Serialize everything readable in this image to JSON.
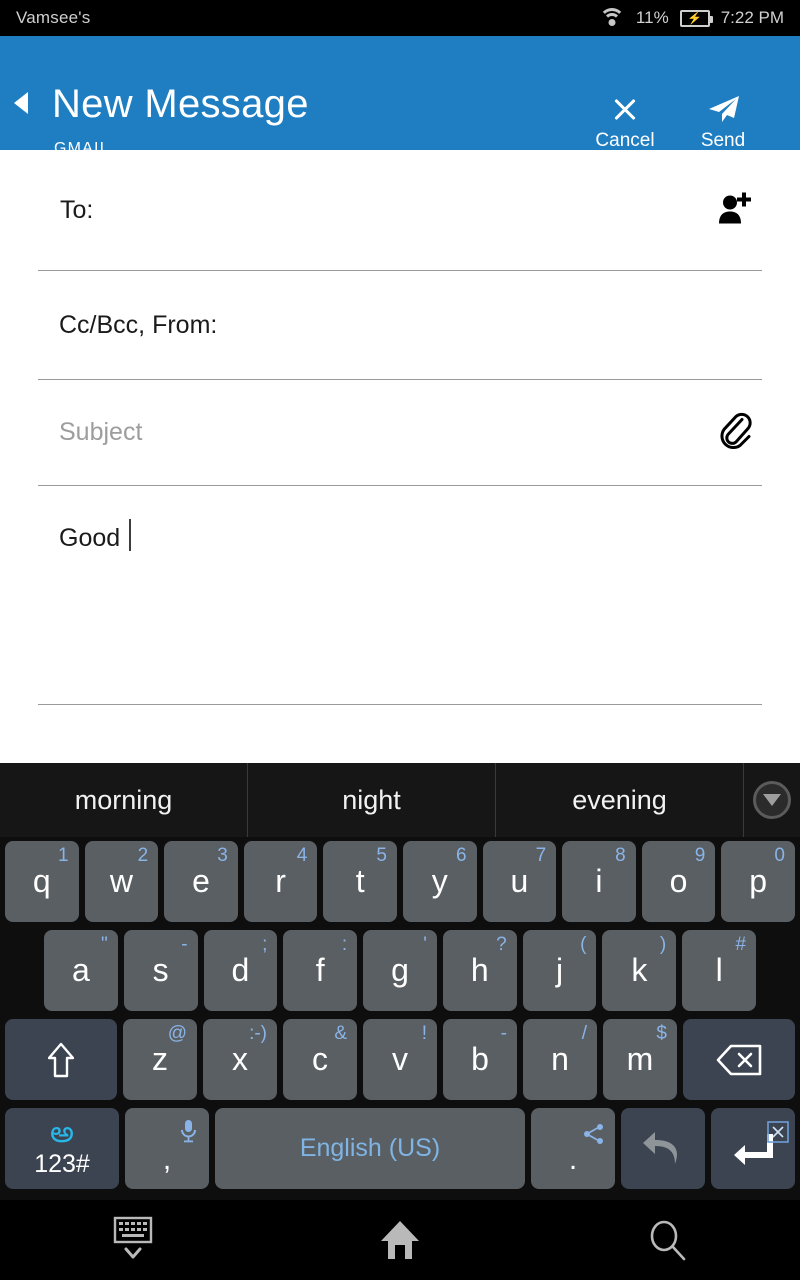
{
  "statusbar": {
    "owner": "Vamsee's",
    "wifi_icon": "wifi-icon",
    "battery_percent": "11%",
    "battery_icon": "battery-charging-icon",
    "time": "7:22 PM"
  },
  "header": {
    "back_icon": "back-arrow-icon",
    "title": "New Message",
    "subtitle": "GMAIL",
    "cancel_icon": "close-icon",
    "cancel_label": "Cancel",
    "send_icon": "send-paper-plane-icon",
    "send_label": "Send",
    "background_color": "#1f7ec1"
  },
  "compose": {
    "to": {
      "label": "To:",
      "value": "",
      "icon": "person-add-icon"
    },
    "ccbcc": {
      "label": "Cc/Bcc, From:",
      "value": ""
    },
    "subject": {
      "placeholder": "Subject",
      "value": "",
      "icon": "paperclip-attach-icon"
    },
    "body": {
      "value": "Good",
      "caret": true
    }
  },
  "keyboard": {
    "suggestions": [
      "morning",
      "night",
      "evening"
    ],
    "expand_icon": "chevron-down-circle-icon",
    "row1": [
      {
        "key": "q",
        "sup": "1"
      },
      {
        "key": "w",
        "sup": "2"
      },
      {
        "key": "e",
        "sup": "3"
      },
      {
        "key": "r",
        "sup": "4"
      },
      {
        "key": "t",
        "sup": "5"
      },
      {
        "key": "y",
        "sup": "6"
      },
      {
        "key": "u",
        "sup": "7"
      },
      {
        "key": "i",
        "sup": "8"
      },
      {
        "key": "o",
        "sup": "9"
      },
      {
        "key": "p",
        "sup": "0"
      }
    ],
    "row2": [
      {
        "key": "a",
        "sup": "\""
      },
      {
        "key": "s",
        "sup": "-"
      },
      {
        "key": "d",
        "sup": ";"
      },
      {
        "key": "f",
        "sup": ":"
      },
      {
        "key": "g",
        "sup": "'"
      },
      {
        "key": "h",
        "sup": "?"
      },
      {
        "key": "j",
        "sup": "("
      },
      {
        "key": "k",
        "sup": ")"
      },
      {
        "key": "l",
        "sup": "#"
      }
    ],
    "row3": [
      {
        "key": "z",
        "sup": "@"
      },
      {
        "key": "x",
        "sup": ":-)"
      },
      {
        "key": "c",
        "sup": "&"
      },
      {
        "key": "v",
        "sup": "!"
      },
      {
        "key": "b",
        "sup": "-"
      },
      {
        "key": "n",
        "sup": "/"
      },
      {
        "key": "m",
        "sup": "$"
      }
    ],
    "shift_icon": "shift-arrow-icon",
    "backspace_icon": "backspace-icon",
    "symbol_key": {
      "glyph": "అ",
      "label": "123#"
    },
    "comma_key": {
      "label": ",",
      "sup_icon": "microphone-icon"
    },
    "space_key": {
      "label": "English (US)"
    },
    "period_key": {
      "label": ".",
      "sup_icon": "share-icon"
    },
    "undo_key": {
      "icon": "undo-arrow-icon"
    },
    "enter_key": {
      "icon": "enter-return-icon",
      "sup_icon": "cut-icon"
    },
    "accent_color": "#8ab4e8"
  },
  "navbar": {
    "hide_keyboard_icon": "keyboard-hide-icon",
    "home_icon": "home-icon",
    "search_icon": "search-icon"
  }
}
